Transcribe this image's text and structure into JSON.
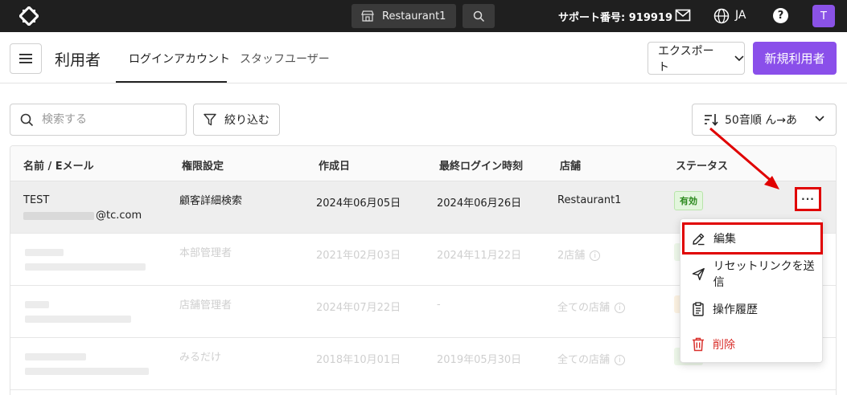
{
  "topbar": {
    "store_name": "Restaurant1",
    "support_text": "サポート番号: 919919",
    "language": "JA",
    "help_symbol": "?",
    "avatar_initial": "T",
    "accent_color": "#8a52e6"
  },
  "header": {
    "title": "利用者",
    "tabs": [
      {
        "label": "ログインアカウント",
        "active": true
      },
      {
        "label": "スタッフユーザー",
        "active": false
      }
    ],
    "export_label": "エクスポート",
    "new_user_label": "新規利用者"
  },
  "toolbar": {
    "search_placeholder": "検索する",
    "filter_label": "絞り込む",
    "sort_label": "50音順 ん→あ"
  },
  "table": {
    "columns": [
      "名前 / Eメール",
      "権限設定",
      "作成日",
      "最終ログイン時刻",
      "店舗",
      "ステータス"
    ],
    "rows": [
      {
        "name": "TEST",
        "email_suffix": "@tc.com",
        "role": "顧客詳細検索",
        "created": "2024年06月05日",
        "last_login": "2024年06月26日",
        "store": "Restaurant1",
        "status": "有効"
      },
      {
        "name": "",
        "email_suffix": "",
        "role": "本部管理者",
        "created": "2021年02月03日",
        "last_login": "2024年11月22日",
        "store": "2店舗",
        "status": ""
      },
      {
        "name": "",
        "email_suffix": "",
        "role": "店舗管理者",
        "created": "2024年07月22日",
        "last_login": "-",
        "store": "全ての店舗",
        "status": ""
      },
      {
        "name": "",
        "email_suffix": "",
        "role": "みるだけ",
        "created": "2018年10月01日",
        "last_login": "2019年05月30日",
        "store": "全ての店舗",
        "status": ""
      }
    ],
    "more_label": "···",
    "info_symbol": "i"
  },
  "row_menu": {
    "items": [
      {
        "label": "編集",
        "icon": "pencil-icon"
      },
      {
        "label": "リセットリンクを送信",
        "icon": "send-icon"
      },
      {
        "label": "操作履歴",
        "icon": "clipboard-icon"
      },
      {
        "label": "削除",
        "icon": "trash-icon",
        "danger": true
      }
    ]
  }
}
